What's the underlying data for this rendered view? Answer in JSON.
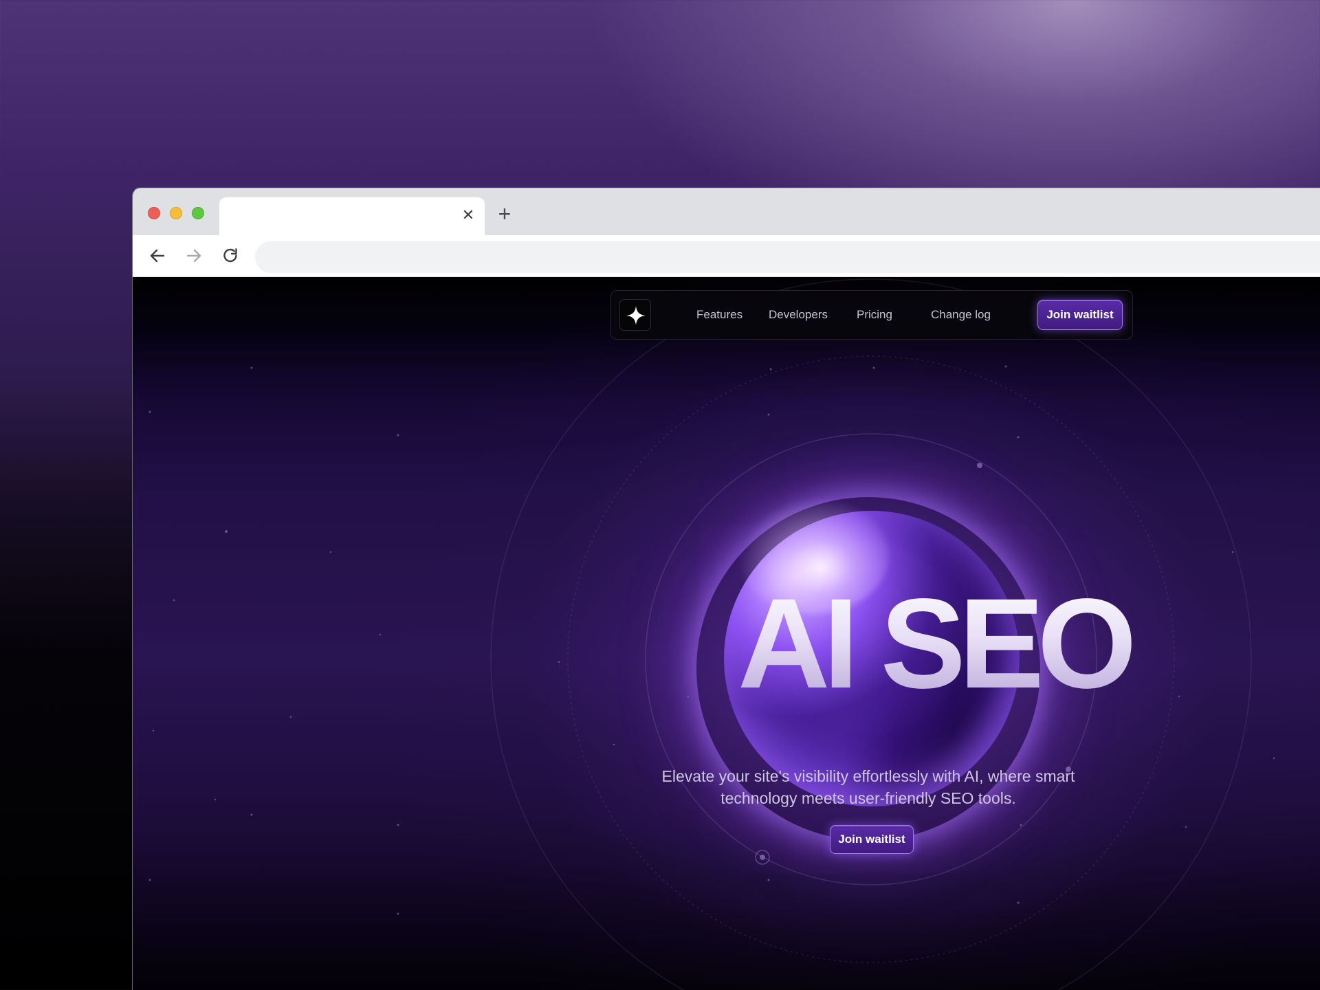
{
  "browser": {
    "tab": {
      "title": "",
      "close_glyph": "✕"
    },
    "new_tab_glyph": "+",
    "url": ""
  },
  "site": {
    "nav": {
      "links": [
        "Features",
        "Developers",
        "Pricing",
        "Change log"
      ],
      "cta_label": "Join waitlist"
    },
    "hero": {
      "title": "AI SEO",
      "subtitle": "Elevate your site's visibility effortlessly with AI, where smart technology meets user-friendly SEO tools.",
      "cta_label": "Join waitlist"
    }
  },
  "colors": {
    "accent": "#5a2aa8",
    "accent_border": "#a179f0",
    "page_background": "#000000",
    "glow": "#8a4ff0"
  },
  "icons": {
    "logo": "sparkle-icon",
    "back": "arrow-left-icon",
    "forward": "arrow-right-icon",
    "reload": "reload-icon",
    "close_tab": "close-icon",
    "new_tab": "plus-icon"
  }
}
